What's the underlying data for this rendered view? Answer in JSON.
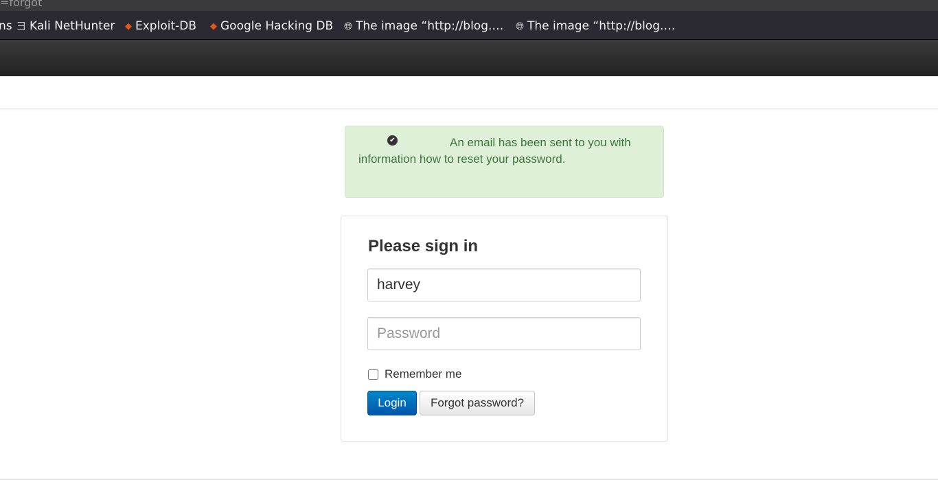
{
  "browser": {
    "url_fragment": "=forgot",
    "bookmarks": [
      {
        "label": "ns",
        "icon": ""
      },
      {
        "label": "Kali NetHunter",
        "icon": "kali-dragon-icon"
      },
      {
        "label": "Exploit-DB",
        "icon": "exploit-db-icon"
      },
      {
        "label": "Google Hacking DB",
        "icon": "exploit-db-icon"
      },
      {
        "label": "The image “http://blog.…",
        "icon": "globe-icon"
      },
      {
        "label": "The image “http://blog.…",
        "icon": "globe-icon"
      }
    ]
  },
  "alert": {
    "icon": "check-circle-icon",
    "message": "An email has been sent to you with information how to reset your password.",
    "color": "#3c763d",
    "background": "#dff0d8"
  },
  "login": {
    "title": "Please sign in",
    "username_value": "harvey",
    "password_placeholder": "Password",
    "remember_label": "Remember me",
    "login_button": "Login",
    "forgot_button": "Forgot password?"
  }
}
